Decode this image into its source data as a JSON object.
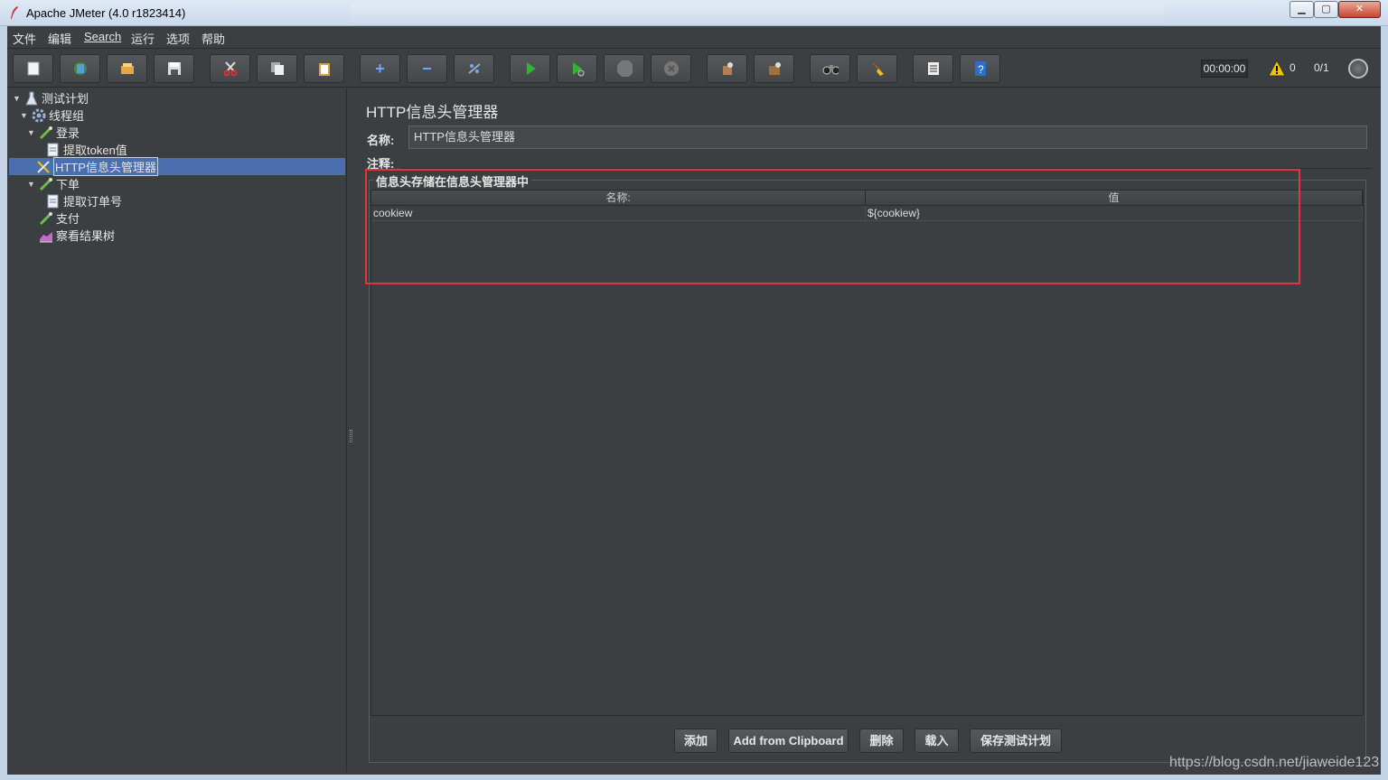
{
  "window": {
    "title": "Apache JMeter (4.0 r1823414)",
    "app_icon": "feather-icon",
    "minimize_glyph": "▁",
    "maximize_glyph": "▢",
    "close_glyph": "✕"
  },
  "menu": [
    "文件",
    "编辑",
    "Search",
    "运行",
    "选项",
    "帮助"
  ],
  "toolbar": {
    "buttons": [
      {
        "name": "new-icon"
      },
      {
        "name": "templates-icon"
      },
      {
        "name": "open-icon"
      },
      {
        "name": "save-icon"
      },
      {
        "name": "cut-icon"
      },
      {
        "name": "copy-icon"
      },
      {
        "name": "paste-icon"
      },
      {
        "name": "expand-icon",
        "glyph": "+"
      },
      {
        "name": "collapse-icon",
        "glyph": "−"
      },
      {
        "name": "toggle-icon"
      },
      {
        "name": "start-icon"
      },
      {
        "name": "start-no-pause-icon"
      },
      {
        "name": "stop-icon"
      },
      {
        "name": "shutdown-icon"
      },
      {
        "name": "clear-icon"
      },
      {
        "name": "clear-all-icon"
      },
      {
        "name": "search-icon"
      },
      {
        "name": "reset-search-icon"
      },
      {
        "name": "function-helper-icon"
      },
      {
        "name": "help-icon"
      }
    ],
    "timer": "00:00:00",
    "warning_count": "0",
    "thread_count": "0/1"
  },
  "tree": {
    "items": [
      {
        "label": "测试计划",
        "icon": "test-plan-icon",
        "expanded": true
      },
      {
        "label": "线程组",
        "icon": "thread-group-gear-icon",
        "expanded": true
      },
      {
        "label": "登录",
        "icon": "sampler-pipette-icon",
        "expanded": true
      },
      {
        "label": "提取token值",
        "icon": "extractor-icon"
      },
      {
        "label": "HTTP信息头管理器",
        "icon": "config-wrench-icon",
        "selected": true
      },
      {
        "label": "下单",
        "icon": "sampler-pipette-icon",
        "expanded": true
      },
      {
        "label": "提取订单号",
        "icon": "extractor-icon"
      },
      {
        "label": "支付",
        "icon": "sampler-pipette-icon"
      },
      {
        "label": "察看结果树",
        "icon": "listener-chart-icon"
      }
    ]
  },
  "main": {
    "title": "HTTP信息头管理器",
    "name_label": "名称:",
    "name_value": "HTTP信息头管理器",
    "comment_label": "注释:",
    "group_title": "信息头存储在信息头管理器中",
    "table": {
      "headers": [
        "名称:",
        "值"
      ],
      "rows": [
        [
          "cookiew",
          "${cookiew}"
        ]
      ]
    },
    "buttons": {
      "add": "添加",
      "clipboard": "Add from Clipboard",
      "delete": "删除",
      "load": "载入",
      "save_plan": "保存测试计划"
    }
  },
  "watermark": "https://blog.csdn.net/jiaweide123",
  "colors": {
    "background": "#3c3f41",
    "selection": "#4b6eaf",
    "highlight_box": "#e3343a"
  }
}
